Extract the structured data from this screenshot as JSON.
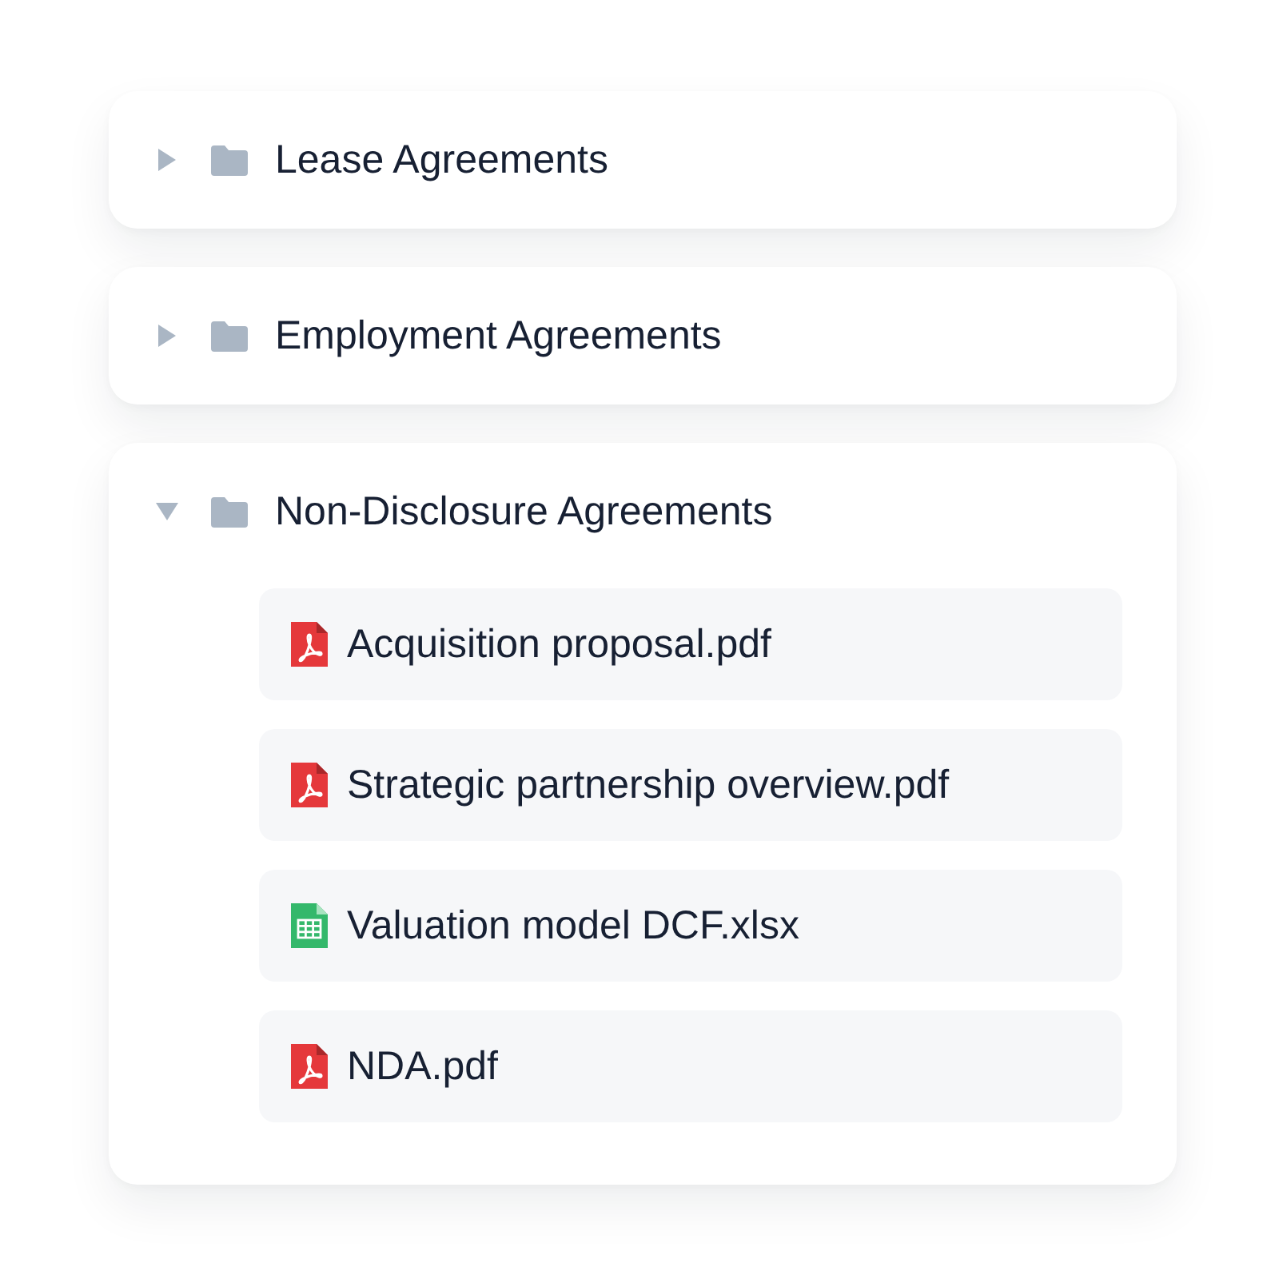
{
  "folders": [
    {
      "name": "Lease Agreements",
      "expanded": false
    },
    {
      "name": "Employment Agreements",
      "expanded": false
    },
    {
      "name": "Non-Disclosure Agreements",
      "expanded": true,
      "children": [
        {
          "name": "Acquisition proposal.pdf",
          "kind": "pdf"
        },
        {
          "name": "Strategic partnership overview.pdf",
          "kind": "pdf"
        },
        {
          "name": "Valuation model DCF.xlsx",
          "kind": "xlsx"
        },
        {
          "name": "NDA.pdf",
          "kind": "pdf"
        }
      ]
    }
  ]
}
